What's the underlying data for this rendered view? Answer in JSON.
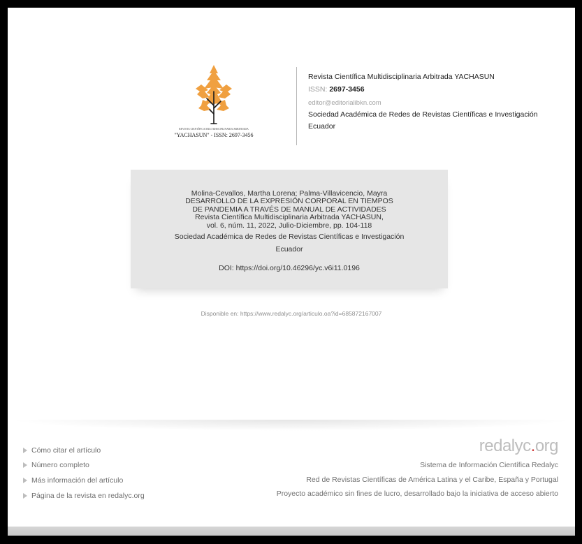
{
  "logo": {
    "small_text": "REVISTA CIENTÍFICA MULTIDISCIPLINARIA ARBITRADA",
    "issn_text": "\"YACHASUN\" - ISSN: 2697-3456",
    "colors": {
      "tree": "#f0a040",
      "trunk": "#1a1a1a"
    }
  },
  "journal": {
    "title": "Revista Científica Multidisciplinaria Arbitrada YACHASUN",
    "issn_label": "ISSN: ",
    "issn_value": "2697-3456",
    "email": "editor@editorialibkn.com",
    "society": "Sociedad Académica de Redes de Revistas Científicas e Investigación",
    "country": "Ecuador"
  },
  "citation": {
    "authors": "Molina-Cevallos, Martha Lorena; Palma-Villavicencio, Mayra",
    "title_line1": "DESARROLLO DE LA EXPRESIÓN CORPORAL EN TIEMPOS",
    "title_line2": "DE PANDEMIA A TRAVÉS DE MANUAL DE ACTIVIDADES",
    "journal_line": "Revista Científica Multidisciplinaria Arbitrada YACHASUN,",
    "volume_line": "vol. 6, núm. 11, 2022, Julio-Diciembre, pp. 104-118",
    "publisher": "Sociedad Académica de Redes de Revistas Científicas e Investigación",
    "country": "Ecuador",
    "doi": "DOI: https://doi.org/10.46296/yc.v6i11.0196"
  },
  "available": "Disponible en: https://www.redalyc.org/articulo.oa?id=685872167007",
  "footer": {
    "links": [
      "Cómo citar el artículo",
      "Número completo",
      "Más información del artículo",
      "Página de la revista en redalyc.org"
    ],
    "logo": {
      "part1": "re",
      "part2": "dalyc",
      "dot": ".",
      "part3": "org"
    },
    "system": "Sistema de Información Científica Redalyc",
    "network": "Red de Revistas Científicas de América Latina y el Caribe, España y Portugal",
    "project": "Proyecto académico sin fines de lucro, desarrollado bajo la iniciativa de acceso abierto"
  }
}
